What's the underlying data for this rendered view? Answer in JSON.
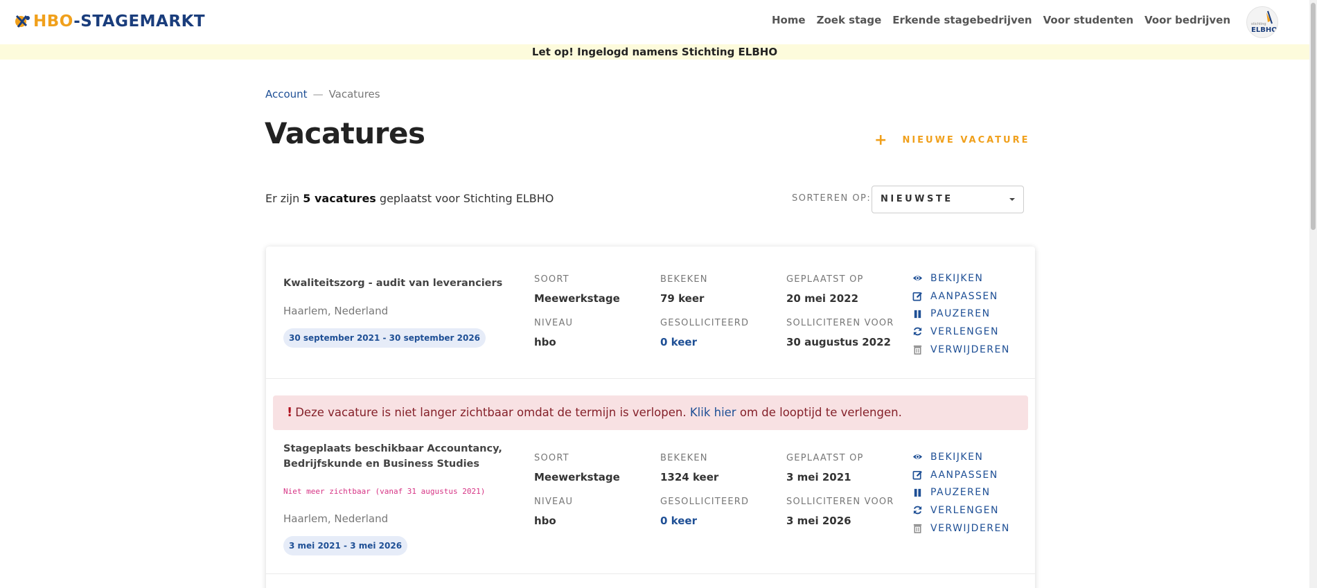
{
  "header": {
    "logo_part1": "HBO",
    "logo_part2": "-STAGEMARKT",
    "nav": [
      "Home",
      "Zoek stage",
      "Erkende stagebedrijven",
      "Voor studenten",
      "Voor bedrijven"
    ],
    "avatar_text_top": "stichting",
    "avatar_text_bottom": "ELBHO"
  },
  "banner": "Let op! Ingelogd namens Stichting ELBHO",
  "breadcrumb": {
    "parent": "Account",
    "separator": "—",
    "current": "Vacatures"
  },
  "page_title": "Vacatures",
  "new_button": {
    "icon": "+",
    "label": "NIEUWE VACATURE"
  },
  "summary": {
    "prefix": "Er zijn",
    "count": "5 vacatures",
    "suffix": "geplaatst voor Stichting ELBHO"
  },
  "sort": {
    "label": "SORTEREN OP:",
    "value": "NIEUWSTE"
  },
  "labels": {
    "soort": "SOORT",
    "niveau": "NIVEAU",
    "bekeken": "BEKEKEN",
    "gesolliciteerd": "GESOLLICITEERD",
    "geplaatst_op": "GEPLAATST OP",
    "solliciteren_voor": "SOLLICITEREN VOOR"
  },
  "actions": [
    "BEKIJKEN",
    "AANPASSEN",
    "PAUZEREN",
    "VERLENGEN",
    "VERWIJDEREN"
  ],
  "vacancies": [
    {
      "title": "Kwaliteitszorg - audit van leveranciers",
      "location": "Haarlem, Nederland",
      "period": "30 september 2021 - 30 september 2026",
      "soort": "Meewerkstage",
      "niveau": "hbo",
      "bekeken": "79 keer",
      "gesolliciteerd": "0 keer",
      "geplaatst_op": "20 mei 2022",
      "solliciteren_voor": "30 augustus 2022"
    },
    {
      "alert": {
        "mark": "!",
        "text_before": "Deze vacature is niet langer zichtbaar omdat de termijn is verlopen.",
        "link": "Klik hier",
        "text_after": "om de looptijd te verlengen."
      },
      "title": "Stageplaats beschikbaar Accountancy, Bedrijfskunde en Business Studies",
      "status": "Niet meer zichtbaar (vanaf 31 augustus 2021)",
      "location": "Haarlem, Nederland",
      "period": "3 mei 2021 - 3 mei 2026",
      "soort": "Meewerkstage",
      "niveau": "hbo",
      "bekeken": "1324 keer",
      "gesolliciteerd": "0 keer",
      "geplaatst_op": "3 mei 2021",
      "solliciteren_voor": "3 mei 2026"
    }
  ],
  "colors": {
    "brand_blue": "#1e4f95",
    "brand_orange": "#f0a01c",
    "alert_bg": "#f8e1e3",
    "banner_bg": "#fdfbdc"
  }
}
